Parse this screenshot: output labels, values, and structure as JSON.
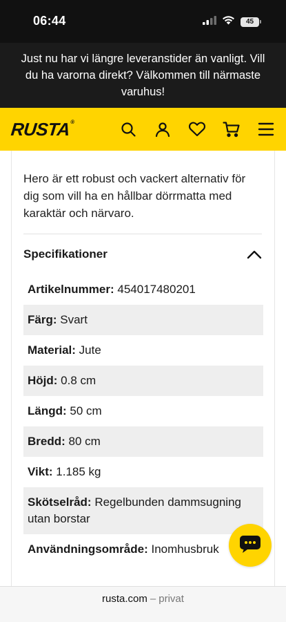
{
  "status_bar": {
    "time": "06:44",
    "battery": "45",
    "icons": [
      "cellular-signal-icon",
      "wifi-icon",
      "battery-icon"
    ]
  },
  "banner": {
    "text": "Just nu har vi längre leveranstider än vanligt. Vill du ha varorna direkt? Välkommen till närmaste varuhus!"
  },
  "header": {
    "logo": "RUSTA",
    "logo_mark": "®",
    "icons": [
      "search-icon",
      "user-icon",
      "heart-icon",
      "cart-icon",
      "menu-icon"
    ],
    "accent_color": "#ffd400"
  },
  "product": {
    "description": "Hero är ett robust och vackert alternativ för dig som vill ha en hållbar dörrmatta med karaktär och närvaro."
  },
  "specifications": {
    "title": "Specifikationer",
    "expanded": true,
    "rows": [
      {
        "label": "Artikelnummer:",
        "value": "454017480201"
      },
      {
        "label": "Färg:",
        "value": "Svart"
      },
      {
        "label": "Material:",
        "value": "Jute"
      },
      {
        "label": "Höjd:",
        "value": "0.8 cm"
      },
      {
        "label": "Längd:",
        "value": "50 cm"
      },
      {
        "label": "Bredd:",
        "value": "80 cm"
      },
      {
        "label": "Vikt:",
        "value": "1.185 kg"
      },
      {
        "label": "Skötselråd:",
        "value": "Regelbunden dammsugning utan borstar"
      },
      {
        "label": "Användningsområde:",
        "value": "Inomhusbruk"
      }
    ]
  },
  "chat": {
    "icon": "chat-bubble-icon"
  },
  "url_bar": {
    "domain": "rusta.com",
    "separator": "–",
    "mode": "privat"
  }
}
